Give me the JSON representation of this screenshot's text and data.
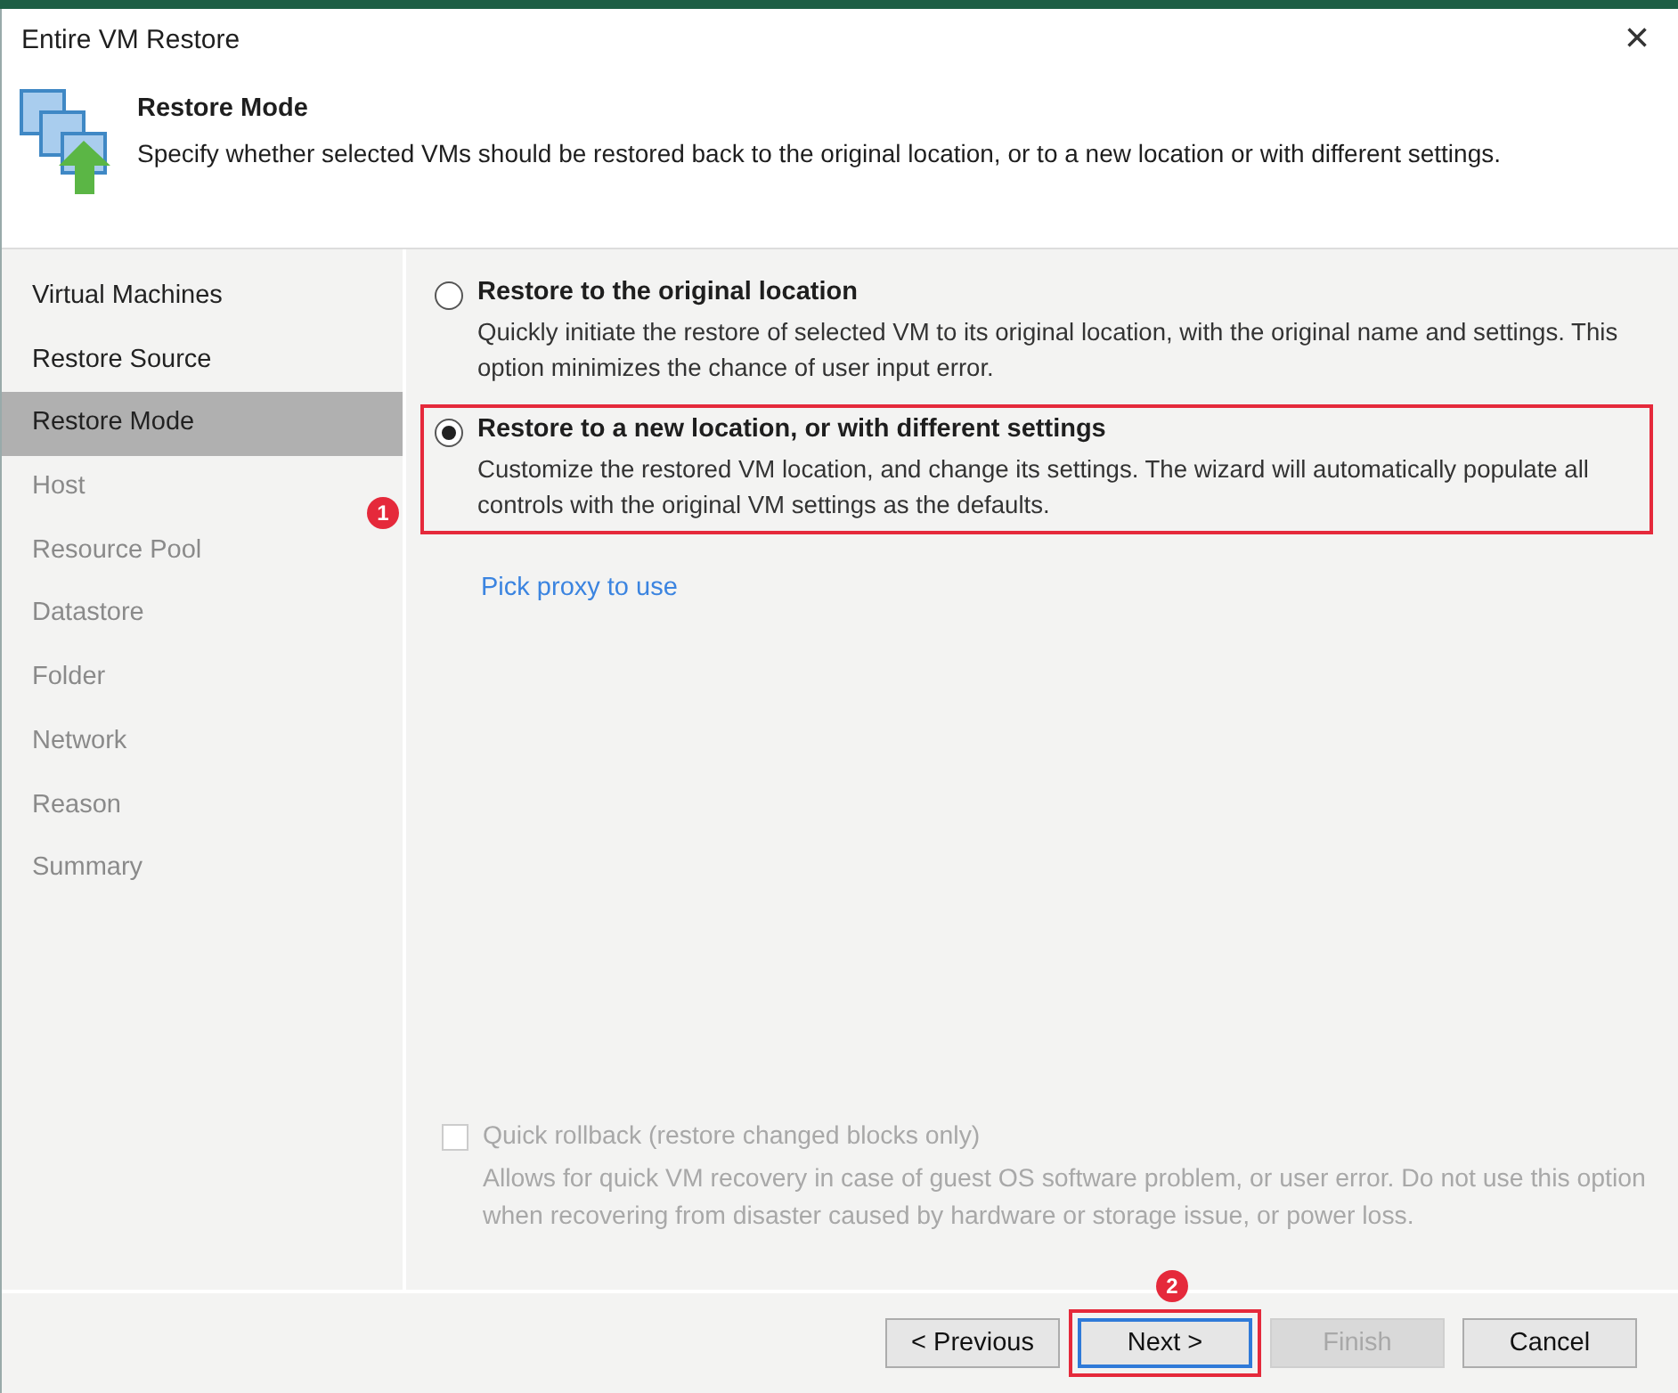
{
  "window": {
    "title": "Entire VM Restore",
    "close": "×"
  },
  "header": {
    "title": "Restore Mode",
    "description": "Specify whether selected VMs should be restored back to the original location, or to a new location or with different settings."
  },
  "sidebar": {
    "items": [
      {
        "label": "Virtual Machines",
        "selected": false,
        "disabled": false
      },
      {
        "label": "Restore Source",
        "selected": false,
        "disabled": false
      },
      {
        "label": "Restore Mode",
        "selected": true,
        "disabled": false
      },
      {
        "label": "Host",
        "selected": false,
        "disabled": true
      },
      {
        "label": "Resource Pool",
        "selected": false,
        "disabled": true
      },
      {
        "label": "Datastore",
        "selected": false,
        "disabled": true
      },
      {
        "label": "Folder",
        "selected": false,
        "disabled": true
      },
      {
        "label": "Network",
        "selected": false,
        "disabled": true
      },
      {
        "label": "Reason",
        "selected": false,
        "disabled": true
      },
      {
        "label": "Summary",
        "selected": false,
        "disabled": true
      }
    ]
  },
  "options": [
    {
      "title": "Restore to the original location",
      "description": "Quickly initiate the restore of selected VM to its original location, with the original name and settings. This option minimizes the chance of user input error.",
      "selected": false,
      "highlighted": false
    },
    {
      "title": "Restore to a new location, or with different settings",
      "description": "Customize the restored VM location, and change its settings. The wizard will automatically populate all controls with the original VM settings as the defaults.",
      "selected": true,
      "highlighted": true,
      "badge": "1"
    }
  ],
  "proxy_link": "Pick proxy to use",
  "quick_rollback": {
    "label": "Quick rollback (restore changed blocks only)",
    "description": "Allows for quick VM recovery in case of guest OS software problem, or user error. Do not use this option when recovering from disaster caused by hardware or storage issue, or power loss.",
    "checked": false,
    "disabled": true
  },
  "buttons": [
    {
      "label": "< Previous",
      "disabled": false,
      "focused": false,
      "highlighted": false
    },
    {
      "label": "Next >",
      "disabled": false,
      "focused": true,
      "highlighted": true,
      "badge": "2"
    },
    {
      "label": "Finish",
      "disabled": true,
      "focused": false,
      "highlighted": false
    },
    {
      "label": "Cancel",
      "disabled": false,
      "focused": false,
      "highlighted": false
    }
  ]
}
